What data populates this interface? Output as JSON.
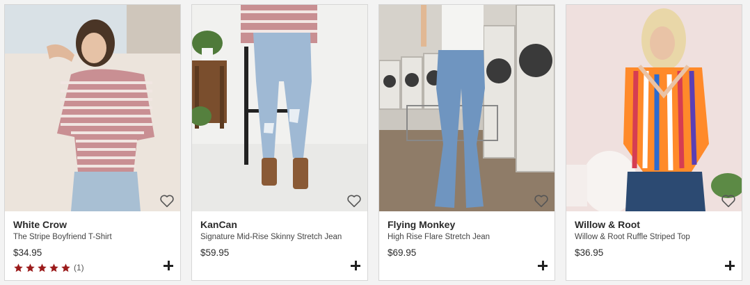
{
  "products": [
    {
      "brand": "White Crow",
      "name": "The Stripe Boyfriend T-Shirt",
      "price": "$34.95",
      "rating": {
        "stars": 5,
        "count": "(1)"
      },
      "image_alt": "Woman in striped boyfriend t-shirt and light jeans"
    },
    {
      "brand": "KanCan",
      "name": "Signature Mid-Rise Skinny Stretch Jean",
      "price": "$59.95",
      "image_alt": "Distressed skinny jeans with brown sandals"
    },
    {
      "brand": "Flying Monkey",
      "name": "High Rise Flare Stretch Jean",
      "price": "$69.95",
      "image_alt": "High rise flare jeans in a laundromat"
    },
    {
      "brand": "Willow & Root",
      "name": "Willow & Root Ruffle Striped Top",
      "price": "$36.95",
      "image_alt": "Woman in colorful ruffle striped top"
    }
  ],
  "colors": {
    "star": "#9b1b1b",
    "card_bg": "#ffffff",
    "page_bg": "#f3f3f3"
  },
  "icons": [
    "heart-icon",
    "plus-icon",
    "star-icon"
  ]
}
